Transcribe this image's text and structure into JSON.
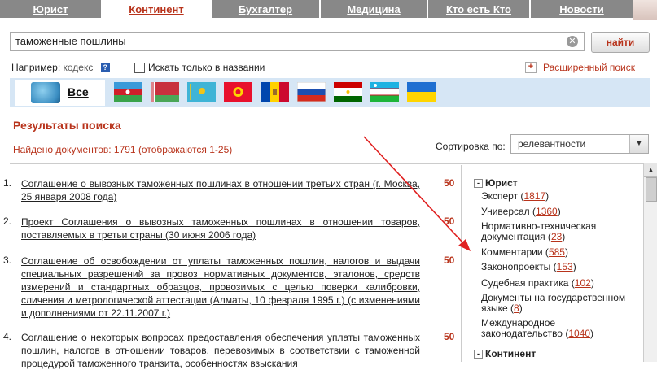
{
  "tabs": [
    {
      "label": "Юрист"
    },
    {
      "label": "Континент"
    },
    {
      "label": "Бухгалтер"
    },
    {
      "label": "Медицина"
    },
    {
      "label": "Кто есть Кто"
    },
    {
      "label": "Новости"
    }
  ],
  "search": {
    "value": "таможенные пошлины",
    "find_label": "найти",
    "example_prefix": "Например:",
    "example_link": "кодекс",
    "help_glyph": "?",
    "title_only_label": "Искать только в названии",
    "advanced_plus": "+",
    "advanced_label": "Расширенный поиск"
  },
  "flags": {
    "all_label": "Все"
  },
  "results": {
    "title": "Результаты поиска",
    "found": "Найдено документов: 1791 (отображаются 1-25)",
    "sort_label": "Сортировка по:",
    "sort_value": "релевантности",
    "items": [
      {
        "num": "1.",
        "text": "Соглашение о вывозных таможенных пошлинах в отношении третьих стран (г. Москва, 25 января 2008 года)",
        "score": "50"
      },
      {
        "num": "2.",
        "text": "Проект Соглашения о вывозных таможенных пошлинах в отношении товаров, поставляемых в третьи страны (30 июня 2006 года)",
        "score": "50"
      },
      {
        "num": "3.",
        "text": "Соглашение об освобождении от уплаты таможенных пошлин, налогов и выдачи специальных разрешений за провоз нормативных документов, эталонов, средств измерений и стандартных образцов, провозимых с целью поверки калибровки, сличения и метрологической аттестации (Алматы, 10 февраля 1995 г.) (с изменениями и дополнениями от 22.11.2007 г.)",
        "score": "50"
      },
      {
        "num": "4.",
        "text": "Соглашение о некоторых вопросах предоставления обеспечения уплаты таможенных пошлин, налогов в отношении товаров, перевозимых в соответствии с таможенной процедурой таможенного транзита, особенностях взыскания",
        "score": "50"
      }
    ]
  },
  "sidebar": {
    "collapse_glyph": "-",
    "groups": [
      {
        "title": "Юрист",
        "items": [
          {
            "label": "Эксперт",
            "count": "1817"
          },
          {
            "label": "Универсал",
            "count": "1360"
          },
          {
            "label": "Нормативно-техническая документация",
            "count": "23"
          },
          {
            "label": "Комментарии",
            "count": "585"
          },
          {
            "label": "Законопроекты",
            "count": "153"
          },
          {
            "label": "Судебная практика",
            "count": "102"
          },
          {
            "label": "Документы на государственном языке",
            "count": "8"
          },
          {
            "label": "Международное законодательство",
            "count": "1040"
          }
        ]
      },
      {
        "title": "Континент",
        "items": []
      }
    ]
  },
  "colors": {
    "accent": "#b8331b",
    "tab_bg": "#888888",
    "flagbar_bg": "#d6e6f5"
  }
}
